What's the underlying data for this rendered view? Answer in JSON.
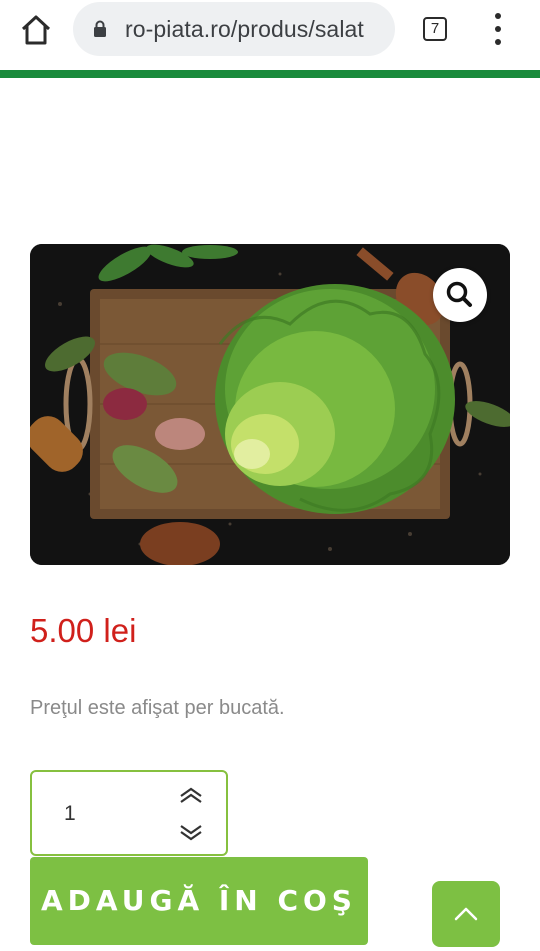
{
  "browser": {
    "url": "ro-piata.ro/produs/salat",
    "tab_count": "7",
    "home_icon": "home-icon",
    "lock_icon": "lock-icon",
    "menu_icon": "more-vert-icon",
    "accent_color": "#1a8a3c"
  },
  "product": {
    "image_subject": "lettuce",
    "zoom_icon": "search-icon",
    "price": "5.00 lei",
    "price_color": "#d0201b",
    "price_note": "Preţul este afişat per bucată."
  },
  "cart": {
    "quantity": "1",
    "increment_icon": "chevron-up-double-icon",
    "decrement_icon": "chevron-down-double-icon",
    "add_label": "ADAUGĂ ÎN COŞ",
    "button_color": "#7dc043"
  },
  "scroll_top": {
    "icon": "chevron-up-icon"
  }
}
